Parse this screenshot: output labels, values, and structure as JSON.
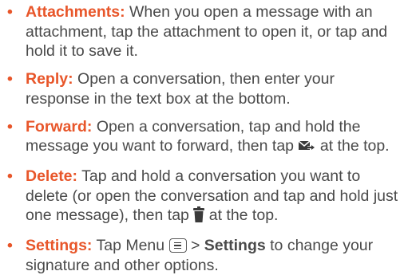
{
  "items": [
    {
      "term": "Attachments:",
      "text": " When you open a message with an attachment, tap the attachment to open it, or tap and hold it to save it."
    },
    {
      "term": "Reply:",
      "text": " Open a conversation, then enter your response in the text box at the bottom."
    },
    {
      "term": "Forward:",
      "text_before": " Open a conversation, tap and hold the message you want to forward, then tap ",
      "icon": "forward-mail-icon",
      "text_after": " at the top."
    },
    {
      "term": "Delete:",
      "text_before": " Tap and hold a conversation you want to delete (or open the conversation and tap and hold just one message), then tap ",
      "icon": "trash-icon",
      "text_after": " at the top."
    },
    {
      "term": "Settings:",
      "text_before": " Tap Menu ",
      "icon": "menu-key-icon",
      "text_mid": " > ",
      "strong": "Settings",
      "text_after": " to change your signature and other options."
    }
  ],
  "bullet_char": "•",
  "colors": {
    "accent": "#e8562a",
    "body_text": "#4a4a4a"
  }
}
